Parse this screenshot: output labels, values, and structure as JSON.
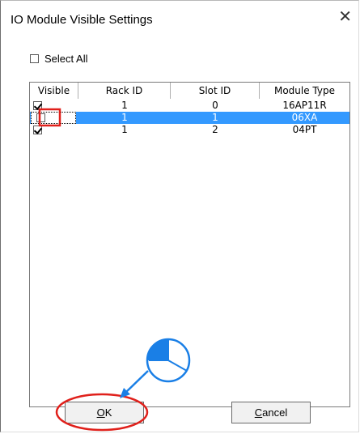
{
  "dialog": {
    "title": "IO Module Visible Settings",
    "close_glyph": "✕"
  },
  "select_all": {
    "label": "Select All",
    "checked": false
  },
  "table": {
    "columns": [
      "Visible",
      "Rack ID",
      "Slot ID",
      "Module Type"
    ],
    "rows": [
      {
        "visible": true,
        "rack_id": "1",
        "slot_id": "0",
        "module_type": "16AP11R",
        "selected": false
      },
      {
        "visible": false,
        "rack_id": "1",
        "slot_id": "1",
        "module_type": "06XA",
        "selected": true
      },
      {
        "visible": true,
        "rack_id": "1",
        "slot_id": "2",
        "module_type": "04PT",
        "selected": false
      }
    ]
  },
  "buttons": {
    "ok": {
      "mnemonic": "O",
      "rest": "K"
    },
    "cancel": {
      "mnemonic": "C",
      "rest": "ancel"
    }
  },
  "annotations": {
    "highlight_color": "#e0201b",
    "pointer_color": "#1a7fe6",
    "mouse_icon": "mouse-left-click-icon"
  }
}
